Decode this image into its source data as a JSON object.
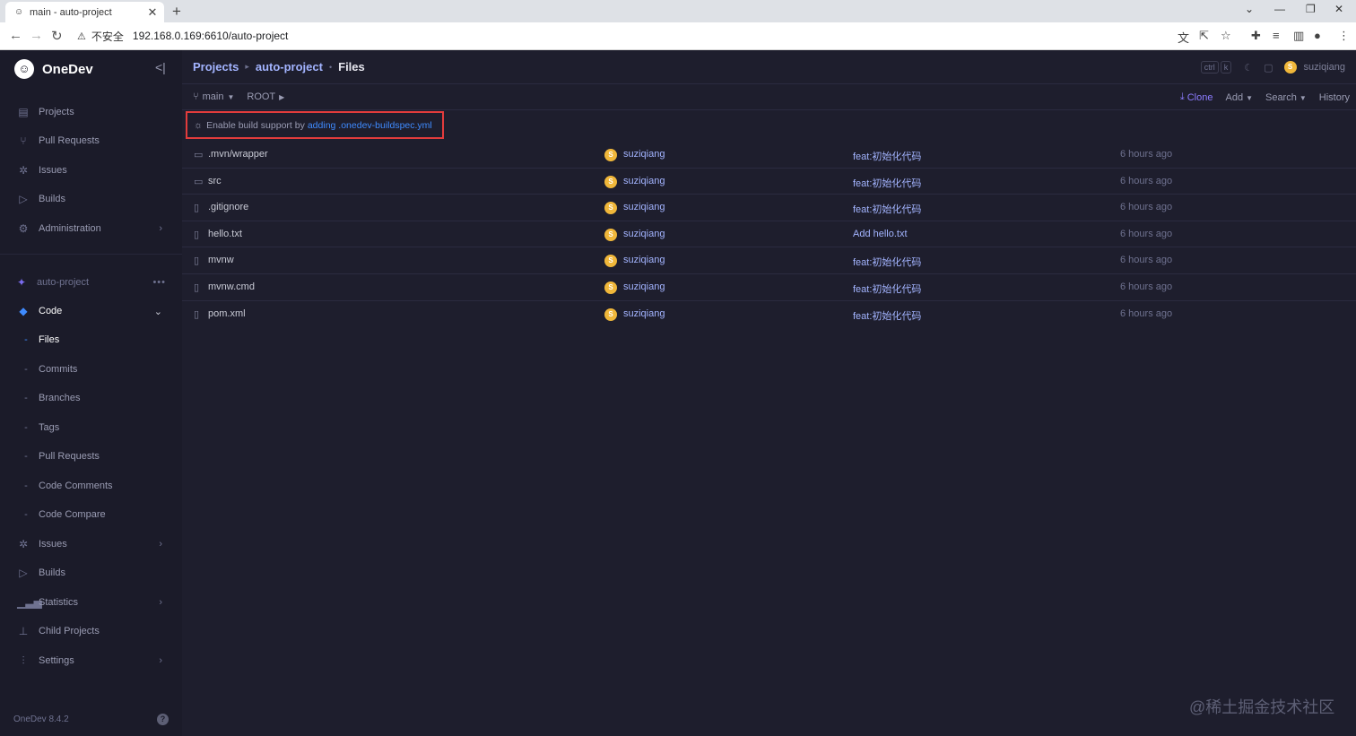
{
  "browser": {
    "tab_title": "main - auto-project",
    "security_label": "不安全",
    "url": "192.168.0.169:6610/auto-project"
  },
  "sidebar": {
    "brand": "OneDev",
    "top_items": [
      {
        "label": "Projects",
        "icon": "projects-icon"
      },
      {
        "label": "Pull Requests",
        "icon": "pull-request-icon"
      },
      {
        "label": "Issues",
        "icon": "bug-icon"
      },
      {
        "label": "Builds",
        "icon": "play-icon"
      },
      {
        "label": "Administration",
        "icon": "gear-icon"
      }
    ],
    "project_name": "auto-project",
    "code_label": "Code",
    "code_sub": [
      "Files",
      "Commits",
      "Branches",
      "Tags",
      "Pull Requests",
      "Code Comments",
      "Code Compare"
    ],
    "bottom_items": [
      "Issues",
      "Builds",
      "Statistics",
      "Child Projects",
      "Settings"
    ],
    "version": "OneDev 8.4.2"
  },
  "header": {
    "crumb_projects": "Projects",
    "crumb_project": "auto-project",
    "crumb_current": "Files",
    "kbd_ctrl": "ctrl",
    "kbd_k": "k",
    "user": "suziqiang",
    "user_initial": "S"
  },
  "toolbar": {
    "branch": "main",
    "path_root": "ROOT",
    "clone": "Clone",
    "add": "Add",
    "search": "Search",
    "history": "History"
  },
  "notice": {
    "text": "Enable build support by",
    "link": "adding .onedev-buildspec.yml"
  },
  "files": [
    {
      "name": ".mvn/wrapper",
      "type": "folder",
      "author": "suziqiang",
      "message": "feat:初始化代码",
      "when": "6 hours ago"
    },
    {
      "name": "src",
      "type": "folder",
      "author": "suziqiang",
      "message": "feat:初始化代码",
      "when": "6 hours ago"
    },
    {
      "name": ".gitignore",
      "type": "file",
      "author": "suziqiang",
      "message": "feat:初始化代码",
      "when": "6 hours ago"
    },
    {
      "name": "hello.txt",
      "type": "file",
      "author": "suziqiang",
      "message": "Add hello.txt",
      "when": "6 hours ago"
    },
    {
      "name": "mvnw",
      "type": "file",
      "author": "suziqiang",
      "message": "feat:初始化代码",
      "when": "6 hours ago"
    },
    {
      "name": "mvnw.cmd",
      "type": "file",
      "author": "suziqiang",
      "message": "feat:初始化代码",
      "when": "6 hours ago"
    },
    {
      "name": "pom.xml",
      "type": "file",
      "author": "suziqiang",
      "message": "feat:初始化代码",
      "when": "6 hours ago"
    }
  ],
  "watermark": "@稀土掘金技术社区",
  "colors": {
    "accent": "#3f8bff",
    "link": "#a3b4ff",
    "clone": "#8c7cff",
    "highlight_border": "#e23c3c",
    "sidebar_bg": "#1b1b29",
    "main_bg": "#1e1e2d"
  }
}
